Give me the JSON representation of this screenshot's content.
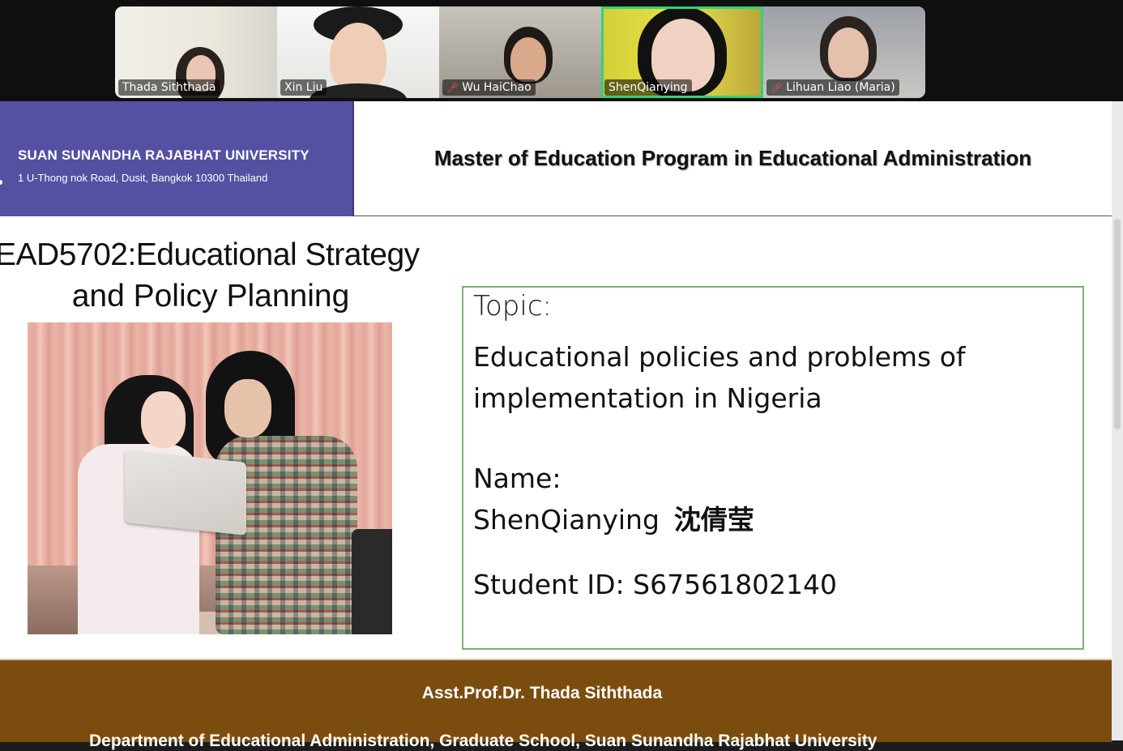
{
  "participants": [
    {
      "name": "Thada Siththada",
      "muted": false,
      "active": false
    },
    {
      "name": "Xin Liu",
      "muted": false,
      "active": false
    },
    {
      "name": "Wu HaiChao",
      "muted": true,
      "active": false
    },
    {
      "name": "ShenQianying",
      "muted": false,
      "active": true
    },
    {
      "name": "Lihuan Liao (Maria)",
      "muted": true,
      "active": false
    }
  ],
  "slide": {
    "university_name": "SUAN SUNANDHA RAJABHAT UNIVERSITY",
    "university_address": "1 U-Thong nok Road, Dusit, Bangkok 10300 Thailand",
    "program_title": "Master of Education Program in Educational Administration",
    "course_line1": "EAD5702:Educational Strategy",
    "course_line2": "and Policy Planning",
    "topic_label": "Topic:",
    "topic_text": "Educational policies and problems of implementation in Nigeria",
    "name_label": "Name:",
    "name_value": "ShenQianying",
    "name_chinese": "沈倩莹",
    "student_id": "Student ID: S67561802140",
    "footer_professor": "Asst.Prof.Dr. Thada Siththada",
    "footer_department": "Department of Educational Administration, Graduate School, Suan Sunandha Rajabhat University"
  },
  "colors": {
    "university_band": "#5451a3",
    "footer_band": "#7a4d0f",
    "active_speaker_border": "#33d17a",
    "topic_box_border": "#7fae76",
    "mute_icon": "#ff4d4d"
  }
}
